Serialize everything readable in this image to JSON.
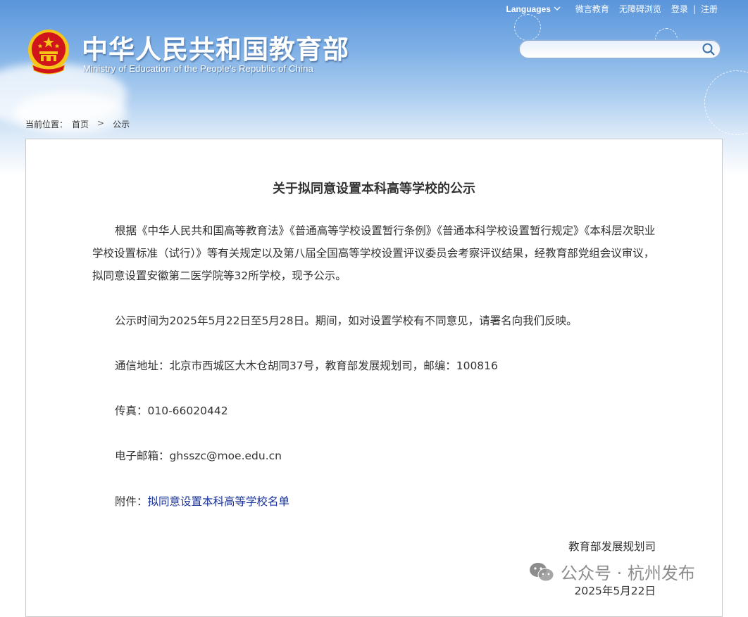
{
  "topnav": {
    "languages": "Languages",
    "wechat": "微言教育",
    "accessibility": "无障碍浏览",
    "login": "登录",
    "divider": "|",
    "register": "注册"
  },
  "site": {
    "title_cn": "中华人民共和国教育部",
    "title_en": "Ministry of Education of the People's Republic of China"
  },
  "search": {
    "placeholder": ""
  },
  "breadcrumb": {
    "prefix": "当前位置：",
    "home": "首页",
    "separator": ">",
    "current": "公示"
  },
  "article": {
    "title": "关于拟同意设置本科高等学校的公示",
    "paragraph1": "根据《中华人民共和国高等教育法》《普通高等学校设置暂行条例》《普通本科学校设置暂行规定》《本科层次职业学校设置标准（试行）》等有关规定以及第八届全国高等学校设置评议委员会考察评议结果，经教育部党组会议审议，拟同意设置安徽第二医学院等32所学校，现予公示。",
    "paragraph2": "公示时间为2025年5月22日至5月28日。期间，如对设置学校有不同意见，请署名向我们反映。",
    "address": "通信地址：北京市西城区大木仓胡同37号，教育部发展规划司，邮编：100816",
    "fax": "传真：010-66020442",
    "email": "电子邮箱：ghsszc@moe.edu.cn",
    "attachment_label": "附件：",
    "attachment_link": "拟同意设置本科高等学校名单",
    "signature": "教育部发展规划司",
    "date": "2025年5月22日"
  },
  "watermark": {
    "text": "公众号 · 杭州发布",
    "icon": "wechat-icon"
  },
  "colors": {
    "header_blue": "#5a95db",
    "link_blue": "#1a3399",
    "text": "#333333",
    "emblem_red": "#d0151b",
    "emblem_gold": "#f5c518"
  }
}
